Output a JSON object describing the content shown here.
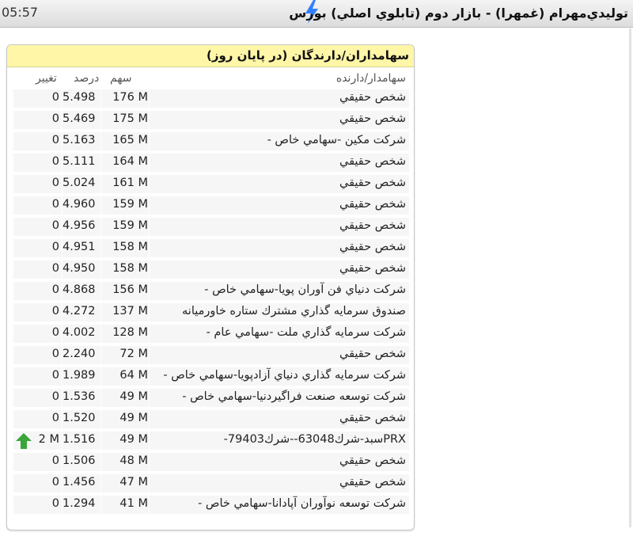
{
  "header": {
    "time": "05:57",
    "title": "توليدي‌مهرام (غمهرا) - بازار دوم (تابلوي اصلي) بورس",
    "bolt_icon": "lightning-icon",
    "bolt_color": "#2f80ff"
  },
  "panel": {
    "title": "سهامداران/دارندگان (در پايان روز)",
    "header_bg": "#fff6a8",
    "columns": {
      "holder": "سهامدار/دارنده",
      "share": "سهم",
      "percent": "درصد",
      "change": "تغيير"
    },
    "rows": [
      {
        "holder": "شخص حقيقي",
        "share": "176 M",
        "percent": "5.498",
        "change": "0"
      },
      {
        "holder": "شخص حقيقي",
        "share": "175 M",
        "percent": "5.469",
        "change": "0"
      },
      {
        "holder": "شركت مكين -سهامي خاص -",
        "share": "165 M",
        "percent": "5.163",
        "change": "0"
      },
      {
        "holder": "شخص حقيقي",
        "share": "164 M",
        "percent": "5.111",
        "change": "0"
      },
      {
        "holder": "شخص حقيقي",
        "share": "161 M",
        "percent": "5.024",
        "change": "0"
      },
      {
        "holder": "شخص حقيقي",
        "share": "159 M",
        "percent": "4.960",
        "change": "0"
      },
      {
        "holder": "شخص حقيقي",
        "share": "159 M",
        "percent": "4.956",
        "change": "0"
      },
      {
        "holder": "شخص حقيقي",
        "share": "158 M",
        "percent": "4.951",
        "change": "0"
      },
      {
        "holder": "شخص حقيقي",
        "share": "158 M",
        "percent": "4.950",
        "change": "0"
      },
      {
        "holder": "شركت دنياي فن آوران پويا-سهامي خاص -",
        "share": "156 M",
        "percent": "4.868",
        "change": "0"
      },
      {
        "holder": "صندوق سرمايه گذاري مشترك ستاره خاورميانه",
        "share": "137 M",
        "percent": "4.272",
        "change": "0"
      },
      {
        "holder": "شركت سرمايه گذاري ملت -سهامي عام -",
        "share": "128 M",
        "percent": "4.002",
        "change": "0"
      },
      {
        "holder": "شخص حقيقي",
        "share": "72 M",
        "percent": "2.240",
        "change": "0"
      },
      {
        "holder": "شركت سرمايه گذاري دنياي آزادپويا-سهامي خاص -",
        "share": "64 M",
        "percent": "1.989",
        "change": "0"
      },
      {
        "holder": "شركت توسعه صنعت فراگيردنيا-سهامي خاص -",
        "share": "49 M",
        "percent": "1.536",
        "change": "0"
      },
      {
        "holder": "شخص حقيقي",
        "share": "49 M",
        "percent": "1.520",
        "change": "0"
      },
      {
        "holder": "PRXسبد-شرك63048--شرك79403-",
        "share": "49 M",
        "percent": "1.516",
        "change": "2 M",
        "arrow": "up-arrow-icon",
        "arrow_color": "#3aa63a"
      },
      {
        "holder": "شخص حقيقي",
        "share": "48 M",
        "percent": "1.506",
        "change": "0"
      },
      {
        "holder": "شخص حقيقي",
        "share": "47 M",
        "percent": "1.456",
        "change": "0"
      },
      {
        "holder": "شركت توسعه نوآوران آپادانا-سهامي خاص -",
        "share": "41 M",
        "percent": "1.294",
        "change": "0"
      }
    ]
  }
}
